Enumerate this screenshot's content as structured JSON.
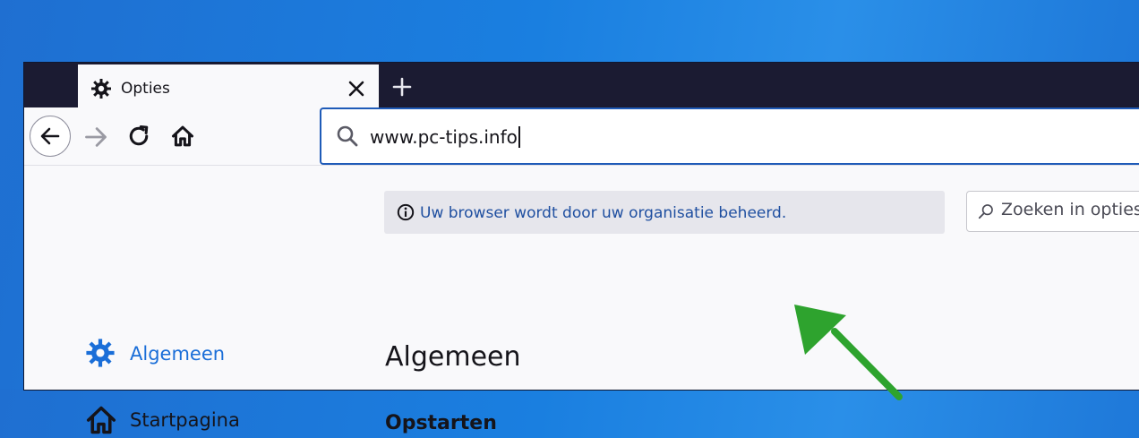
{
  "tab": {
    "title": "Opties",
    "icon": "gear-icon"
  },
  "toolbar": {
    "back_icon": "back-arrow-icon",
    "forward_icon": "forward-arrow-icon",
    "reload_icon": "reload-icon",
    "home_icon": "home-icon"
  },
  "urlbar": {
    "value": "www.pc-tips.info"
  },
  "policy": {
    "message": "Uw browser wordt door uw organisatie beheerd."
  },
  "search": {
    "placeholder": "Zoeken in opties"
  },
  "sidebar": {
    "items": [
      {
        "label": "Algemeen",
        "icon": "gear-icon",
        "selected": true
      },
      {
        "label": "Startpagina",
        "icon": "home-icon",
        "selected": false
      }
    ]
  },
  "main": {
    "title": "Algemeen",
    "section": "Opstarten"
  },
  "colors": {
    "accent": "#1a6ed8",
    "link": "#1f4fa0",
    "arrow": "#2ea32e",
    "tabstrip": "#1b1b32"
  }
}
